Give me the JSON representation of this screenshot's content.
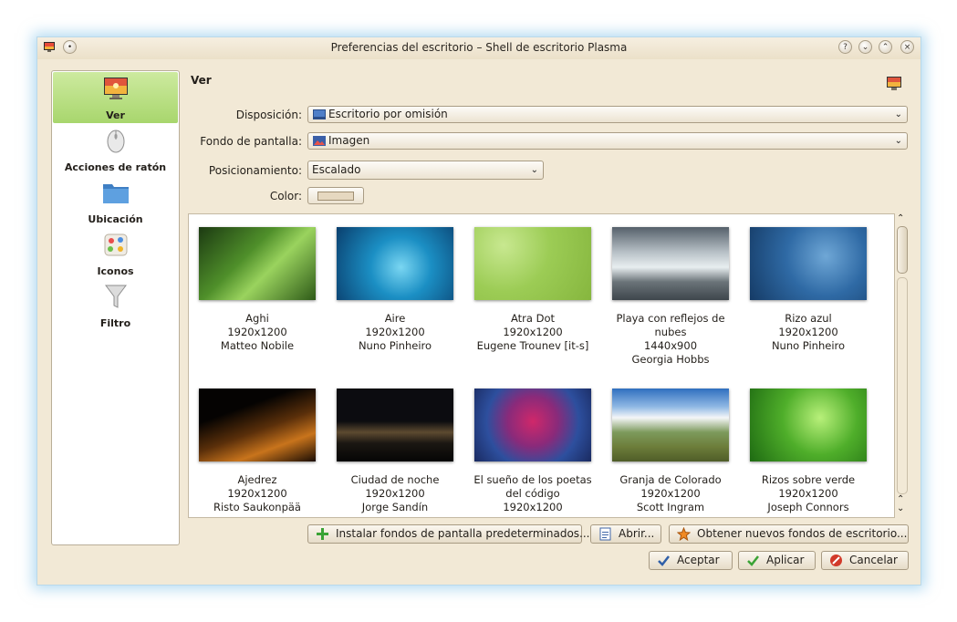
{
  "window": {
    "title": "Preferencias del escritorio – Shell de escritorio Plasma",
    "controls": [
      "?",
      "⌄",
      "⌃",
      "×"
    ]
  },
  "sidebar": {
    "items": [
      {
        "label": "Ver",
        "icon": "monitor-icon",
        "selected": true
      },
      {
        "label": "Acciones de ratón",
        "icon": "mouse-icon",
        "selected": false
      },
      {
        "label": "Ubicación",
        "icon": "folder-icon",
        "selected": false
      },
      {
        "label": "Iconos",
        "icon": "icons-palette-icon",
        "selected": false
      },
      {
        "label": "Filtro",
        "icon": "funnel-icon",
        "selected": false
      }
    ]
  },
  "main": {
    "heading": "Ver",
    "fields": {
      "layout_label": "Disposición:",
      "layout_value": "Escritorio por omisión",
      "wallpaper_label": "Fondo de pantalla:",
      "wallpaper_value": "Imagen",
      "positioning_label": "Posicionamiento:",
      "positioning_value": "Escalado",
      "color_label": "Color:",
      "color_value": "#e6d8c0"
    }
  },
  "wallpapers": [
    {
      "name": "Aghi",
      "resolution": "1920x1200",
      "author": "Matteo Nobile"
    },
    {
      "name": "Aire",
      "resolution": "1920x1200",
      "author": "Nuno Pinheiro"
    },
    {
      "name": "Atra Dot",
      "resolution": "1920x1200",
      "author": "Eugene Trounev [it-s]"
    },
    {
      "name": "Playa con reflejos de nubes",
      "resolution": "1440x900",
      "author": "Georgia Hobbs"
    },
    {
      "name": "Rizo azul",
      "resolution": "1920x1200",
      "author": "Nuno Pinheiro"
    },
    {
      "name": "Ajedrez",
      "resolution": "1920x1200",
      "author": "Risto Saukonpää"
    },
    {
      "name": "Ciudad de noche",
      "resolution": "1920x1200",
      "author": "Jorge Sandín"
    },
    {
      "name": "El sueño de los poetas del código",
      "resolution": "1920x1200",
      "author": ""
    },
    {
      "name": "Granja de Colorado",
      "resolution": "1920x1200",
      "author": "Scott Ingram"
    },
    {
      "name": "Rizos sobre verde",
      "resolution": "1920x1200",
      "author": "Joseph Connors"
    }
  ],
  "buttons": {
    "install": "Instalar fondos de pantalla predeterminados...",
    "open": "Abrir...",
    "get_new": "Obtener nuevos fondos de escritorio...",
    "accept": "Aceptar",
    "apply": "Aplicar",
    "cancel": "Cancelar"
  },
  "colors": {
    "window_bg": "#f2e9d6",
    "selected_item": "#a8d66d",
    "glow": "#78bee6"
  }
}
